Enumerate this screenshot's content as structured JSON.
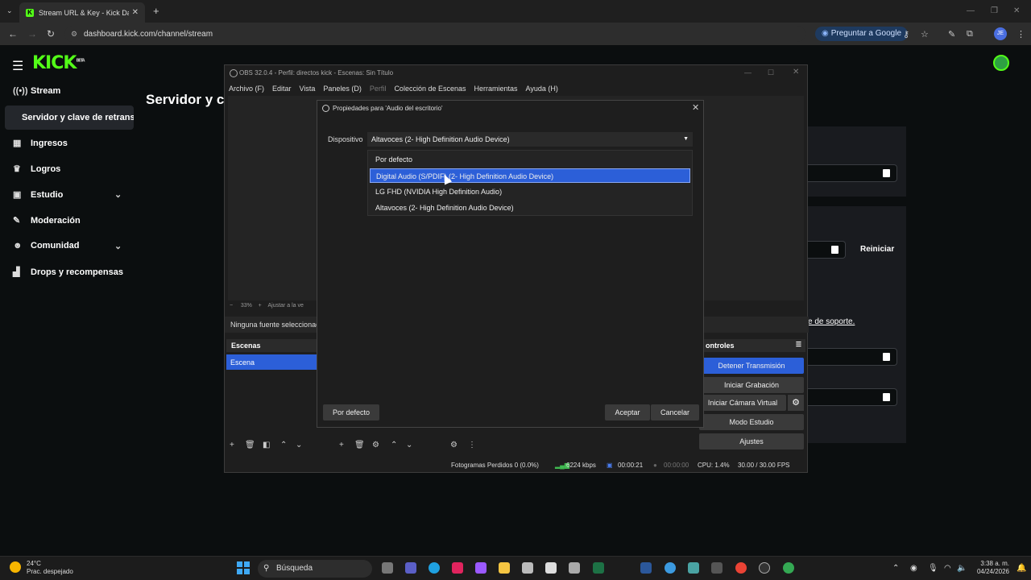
{
  "browser": {
    "tab_title": "Stream URL & Key - Kick Dashb",
    "url": "dashboard.kick.com/channel/stream",
    "ask_google": "Preguntar a Google",
    "profile_initials": "JE"
  },
  "kick": {
    "logo": "KICK",
    "logo_beta": "BETA",
    "sidebar": [
      {
        "label": "Stream",
        "icon": "broadcast-icon"
      },
      {
        "label": "Servidor y clave de retransn",
        "icon": "",
        "active": true
      },
      {
        "label": "Ingresos",
        "icon": "chart-icon"
      },
      {
        "label": "Logros",
        "icon": "trophy-icon"
      },
      {
        "label": "Estudio",
        "icon": "studio-icon"
      },
      {
        "label": "Moderación",
        "icon": "wrench-icon"
      },
      {
        "label": "Comunidad",
        "icon": "people-icon"
      },
      {
        "label": "Drops y recompensas",
        "icon": "gift-icon"
      }
    ],
    "heading": "Servidor y cl",
    "reiniciar": "Reiniciar",
    "soporte": "e de soporte."
  },
  "obs": {
    "title": "OBS 32.0.4 - Perfil: directos kick - Escenas: Sin Título",
    "menu": [
      "Archivo (F)",
      "Editar",
      "Vista",
      "Paneles (D)",
      "Perfil",
      "Colección de Escenas",
      "Herramientas",
      "Ayuda (H)"
    ],
    "zoom": "33%",
    "zoom_fit": "Ajustar a la ve",
    "no_source": "Ninguna fuente seleccionad",
    "scenes_header": "Escenas",
    "scene_item": "Escena",
    "controls_header": "ontroles",
    "controls": {
      "stop_stream": "Detener Transmisión",
      "start_record": "Iniciar Grabación",
      "virtual_cam": "Iniciar Cámara Virtual",
      "studio_mode": "Modo Estudio",
      "settings": "Ajustes"
    },
    "status": {
      "dropped": "Fotogramas Perdidos 0 (0.0%)",
      "bitrate": "6224 kbps",
      "stream_time": "00:00:21",
      "record_time": "00:00:00",
      "cpu": "CPU: 1.4%",
      "fps": "30.00 / 30.00 FPS"
    }
  },
  "dialog": {
    "title": "Propiedades para 'Audio del escritorio'",
    "device_label": "Dispositivo",
    "device_value": "Altavoces (2- High Definition Audio Device)",
    "options": [
      "Por defecto",
      "Digital Audio (S/PDIF) (2- High Definition Audio Device)",
      "LG FHD (NVIDIA High Definition Audio)",
      "Altavoces (2- High Definition Audio Device)"
    ],
    "selected_option_index": 1,
    "default_btn": "Por defecto",
    "accept_btn": "Aceptar",
    "cancel_btn": "Cancelar"
  },
  "taskbar": {
    "temperature": "24°C",
    "weather": "Prac. despejado",
    "search": "Búsqueda",
    "time": "3:38 a. m.",
    "date": "04/24/2026"
  },
  "colors": {
    "kick_green": "#53fc18",
    "obs_accent": "#2c5fd8"
  }
}
